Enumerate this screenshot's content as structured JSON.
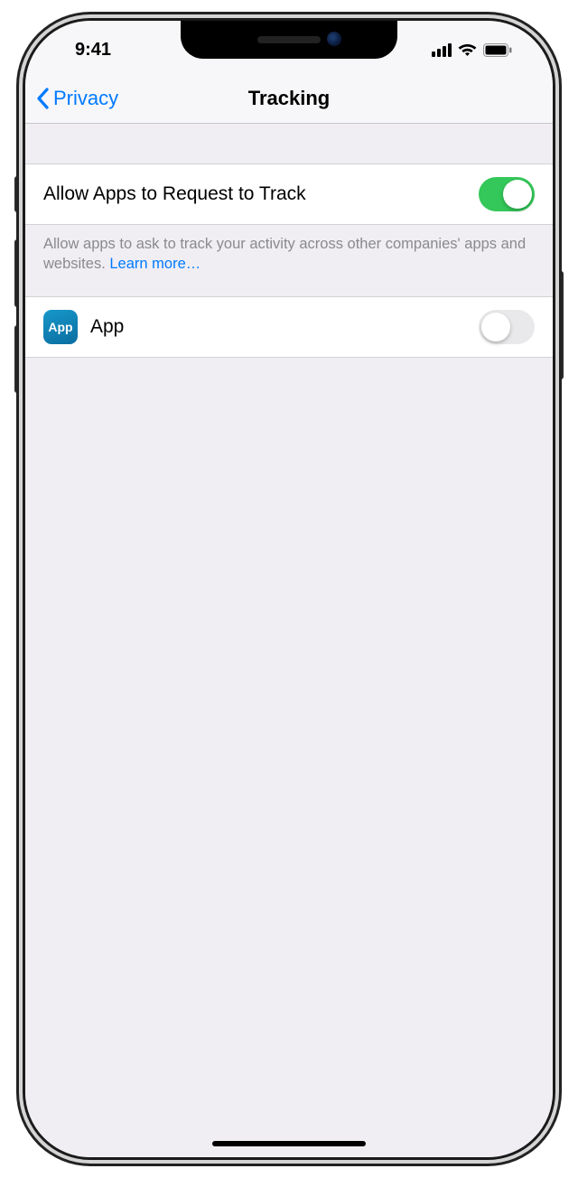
{
  "status": {
    "time": "9:41"
  },
  "nav": {
    "back_label": "Privacy",
    "title": "Tracking"
  },
  "allow": {
    "label": "Allow Apps to Request to Track",
    "enabled": true
  },
  "footnote": {
    "text": "Allow apps to ask to track your activity across other companies' apps and websites. ",
    "link": "Learn more…"
  },
  "apps": [
    {
      "icon_label": "App",
      "name": "App",
      "enabled": false
    }
  ]
}
